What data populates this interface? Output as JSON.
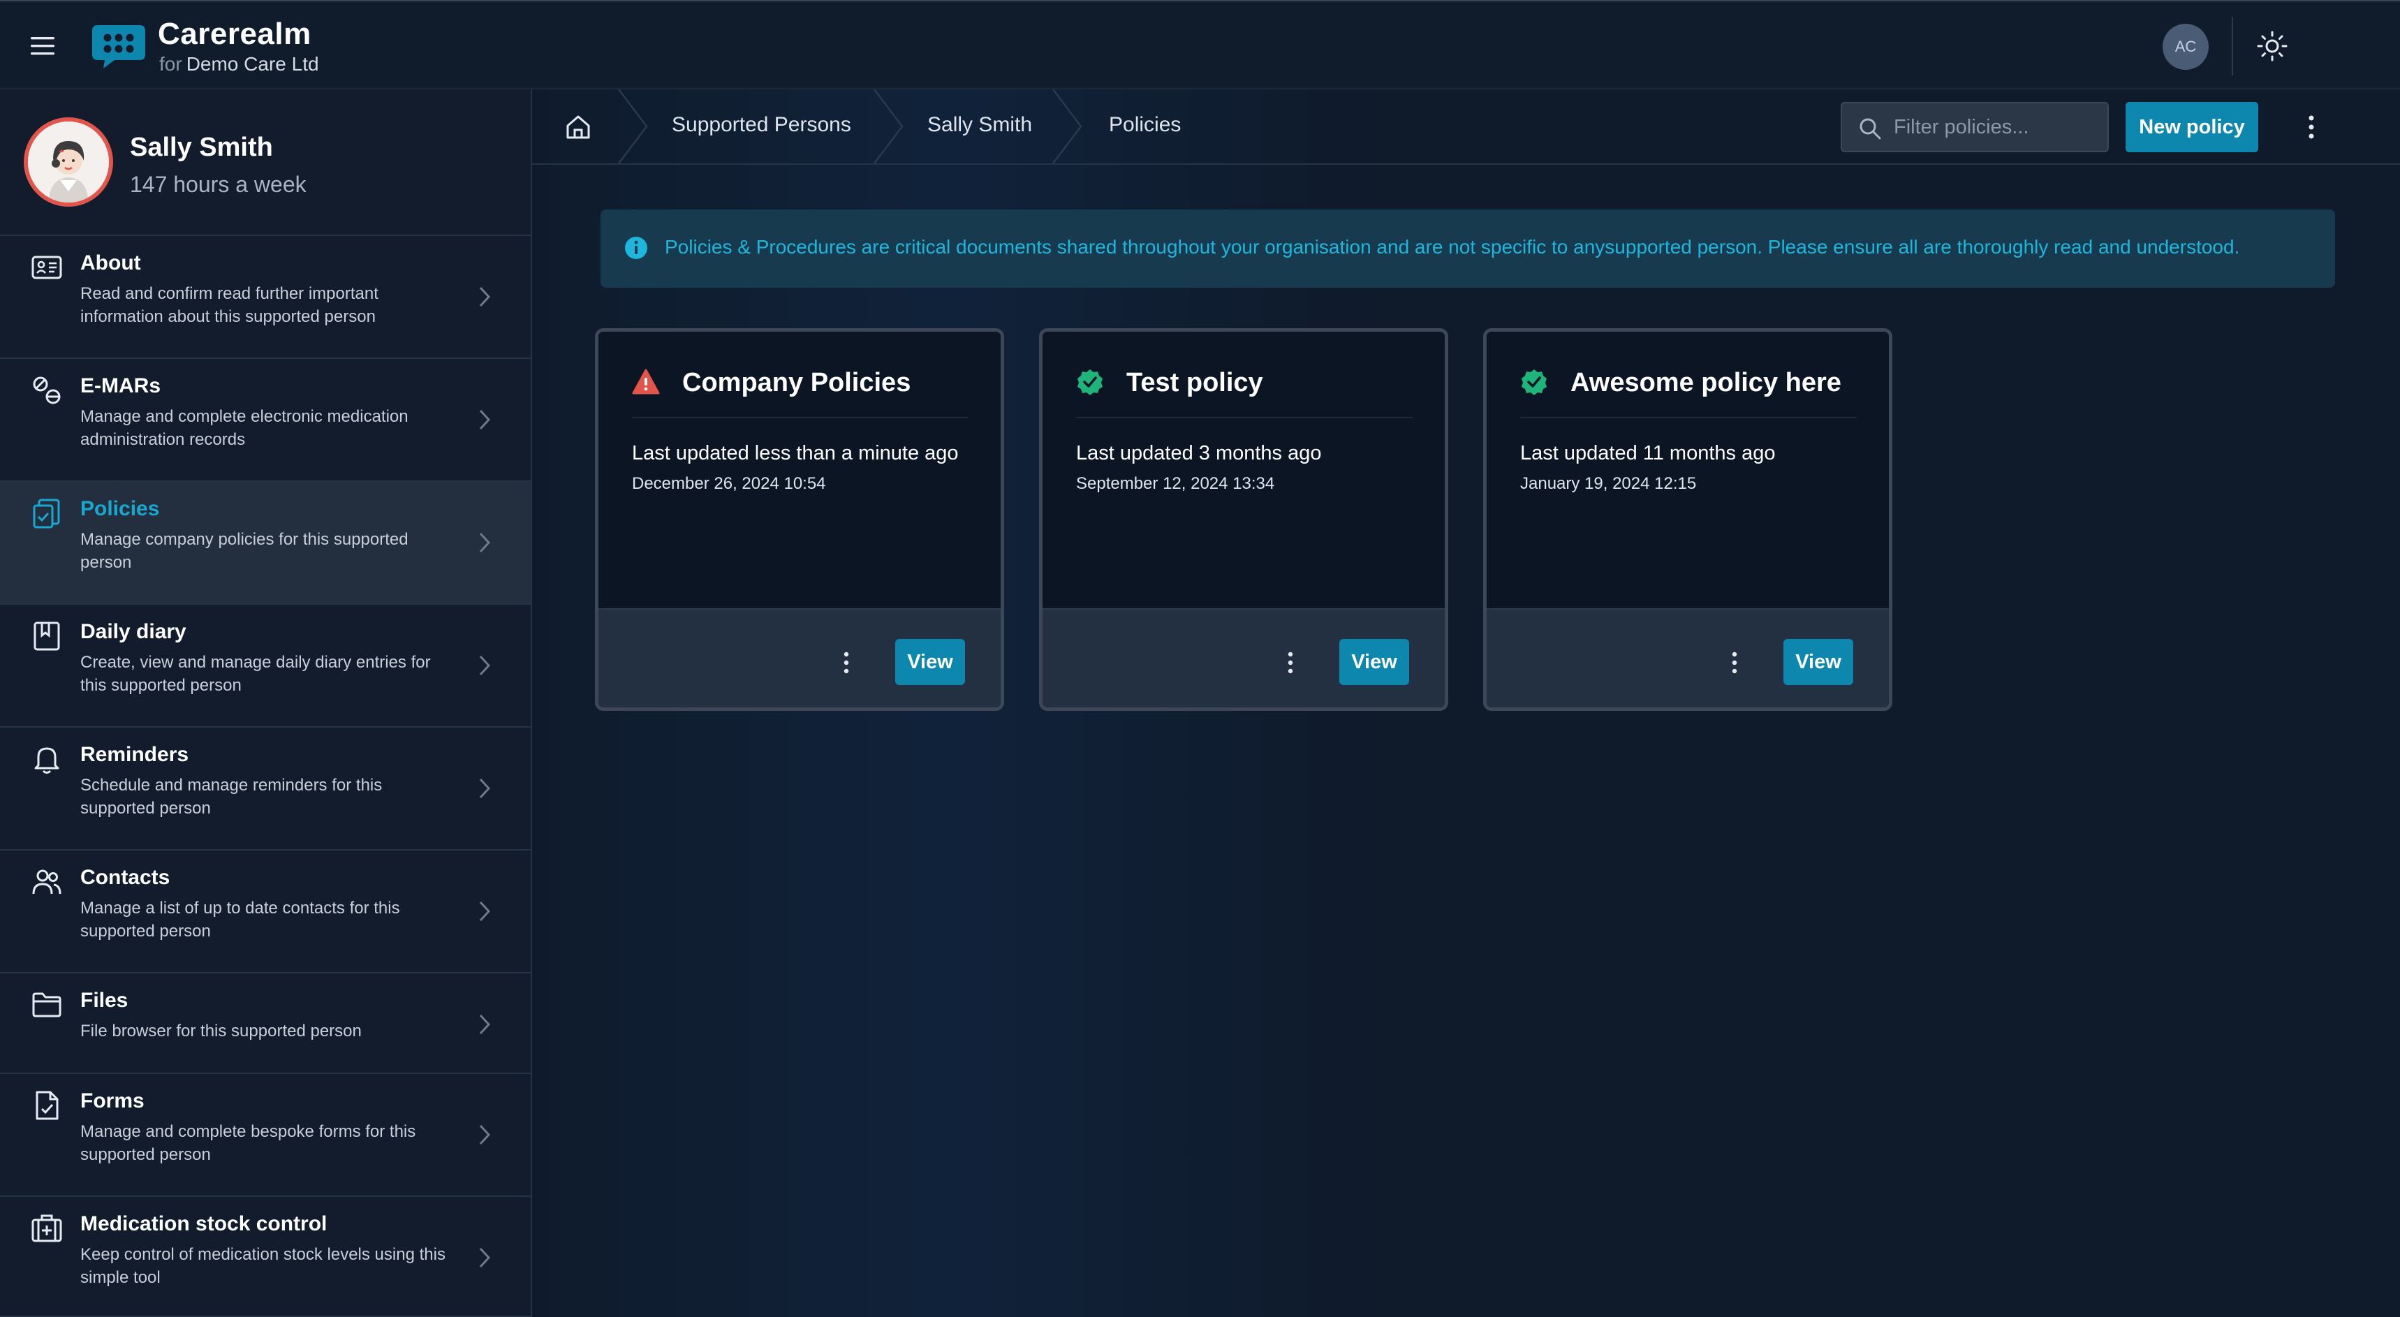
{
  "app": {
    "name": "Carerealm",
    "for_prefix": "for",
    "org": "Demo Care Ltd",
    "user_initials": "AC",
    "icons": {
      "menu": "hamburger-icon",
      "theme": "sun-icon",
      "logo": "chat-bubble-logo"
    }
  },
  "colors": {
    "accent": "#0d87ad",
    "accent_text": "#19a8d0",
    "background": "#0f1a2b",
    "warning": "#e2554a",
    "success": "#1fb57a"
  },
  "profile": {
    "name": "Sally Smith",
    "hours": "147 hours a week"
  },
  "sidebar": {
    "items": [
      {
        "title": "About",
        "desc": "Read and confirm read further important information about this supported person",
        "icon": "id-card-icon",
        "active": false
      },
      {
        "title": "E-MARs",
        "desc": "Manage and complete electronic medication administration records",
        "icon": "pills-icon",
        "active": false
      },
      {
        "title": "Policies",
        "desc": "Manage company policies for this supported person",
        "icon": "clipboard-check-icon",
        "active": true
      },
      {
        "title": "Daily diary",
        "desc": "Create, view and manage daily diary entries for this supported person",
        "icon": "book-icon",
        "active": false
      },
      {
        "title": "Reminders",
        "desc": "Schedule and manage reminders for this supported person",
        "icon": "bell-icon",
        "active": false
      },
      {
        "title": "Contacts",
        "desc": "Manage a list of up to date contacts for this supported person",
        "icon": "users-icon",
        "active": false
      },
      {
        "title": "Files",
        "desc": "File browser for this supported person",
        "icon": "folder-icon",
        "active": false
      },
      {
        "title": "Forms",
        "desc": "Manage and complete bespoke forms for this supported person",
        "icon": "form-check-icon",
        "active": false
      },
      {
        "title": "Medication stock control",
        "desc": "Keep control of medication stock levels using this simple tool",
        "icon": "medical-kit-icon",
        "active": false
      }
    ]
  },
  "breadcrumb": {
    "items": [
      "Supported Persons",
      "Sally Smith",
      "Policies"
    ],
    "home_icon": "home-icon"
  },
  "toolbar": {
    "filter_placeholder": "Filter policies...",
    "new_label": "New policy"
  },
  "banner": {
    "text": "Policies & Procedures are critical documents shared throughout your organisation and are not specific to anysupported person. Please ensure all are thoroughly read and understood."
  },
  "policies": [
    {
      "title": "Company Policies",
      "status": "warning",
      "updated": "Last updated less than a minute ago",
      "date": "December 26, 2024 10:54",
      "view_label": "View"
    },
    {
      "title": "Test policy",
      "status": "read",
      "updated": "Last updated 3 months ago",
      "date": "September 12, 2024 13:34",
      "view_label": "View"
    },
    {
      "title": "Awesome policy here",
      "status": "read",
      "updated": "Last updated 11 months ago",
      "date": "January 19, 2024 12:15",
      "view_label": "View"
    }
  ]
}
